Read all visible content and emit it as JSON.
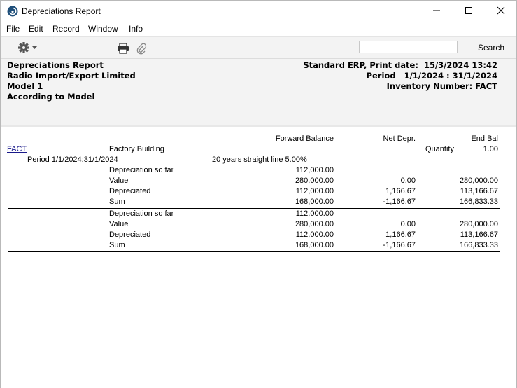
{
  "window": {
    "title": "Depreciations Report"
  },
  "menu": [
    "File",
    "Edit",
    "Record",
    "Window",
    "Info"
  ],
  "toolbar": {
    "search_placeholder": "",
    "search_label": "Search"
  },
  "header": {
    "left": [
      "Depreciations Report",
      "Radio Import/Export Limited",
      "Model 1",
      "According to Model"
    ],
    "right": [
      "Standard ERP, Print date:  15/3/2024 13:42",
      "Period   1/1/2024 : 31/1/2024",
      "Inventory Number: FACT"
    ]
  },
  "columns": {
    "forward": "Forward Balance",
    "net": "Net Depr.",
    "end": "End Bal"
  },
  "item": {
    "code": "FACT",
    "name": "Factory Building",
    "quantity_label": "Quantity",
    "quantity": "1.00",
    "period": "Period 1/1/2024:31/1/2024",
    "method": "20 years straight line 5.00%"
  },
  "section1": [
    {
      "label": "Depreciation so far",
      "forward": "112,000.00",
      "net": "",
      "end": ""
    },
    {
      "label": "Value",
      "forward": "280,000.00",
      "net": "0.00",
      "end": "280,000.00"
    },
    {
      "label": "Depreciated",
      "forward": "112,000.00",
      "net": "1,166.67",
      "end": "113,166.67"
    },
    {
      "label": "Sum",
      "forward": "168,000.00",
      "net": "-1,166.67",
      "end": "166,833.33"
    }
  ],
  "section2": [
    {
      "label": "Depreciation so far",
      "forward": "112,000.00",
      "net": "",
      "end": ""
    },
    {
      "label": "Value",
      "forward": "280,000.00",
      "net": "0.00",
      "end": "280,000.00"
    },
    {
      "label": "Depreciated",
      "forward": "112,000.00",
      "net": "1,166.67",
      "end": "113,166.67"
    },
    {
      "label": "Sum",
      "forward": "168,000.00",
      "net": "-1,166.67",
      "end": "166,833.33"
    }
  ]
}
